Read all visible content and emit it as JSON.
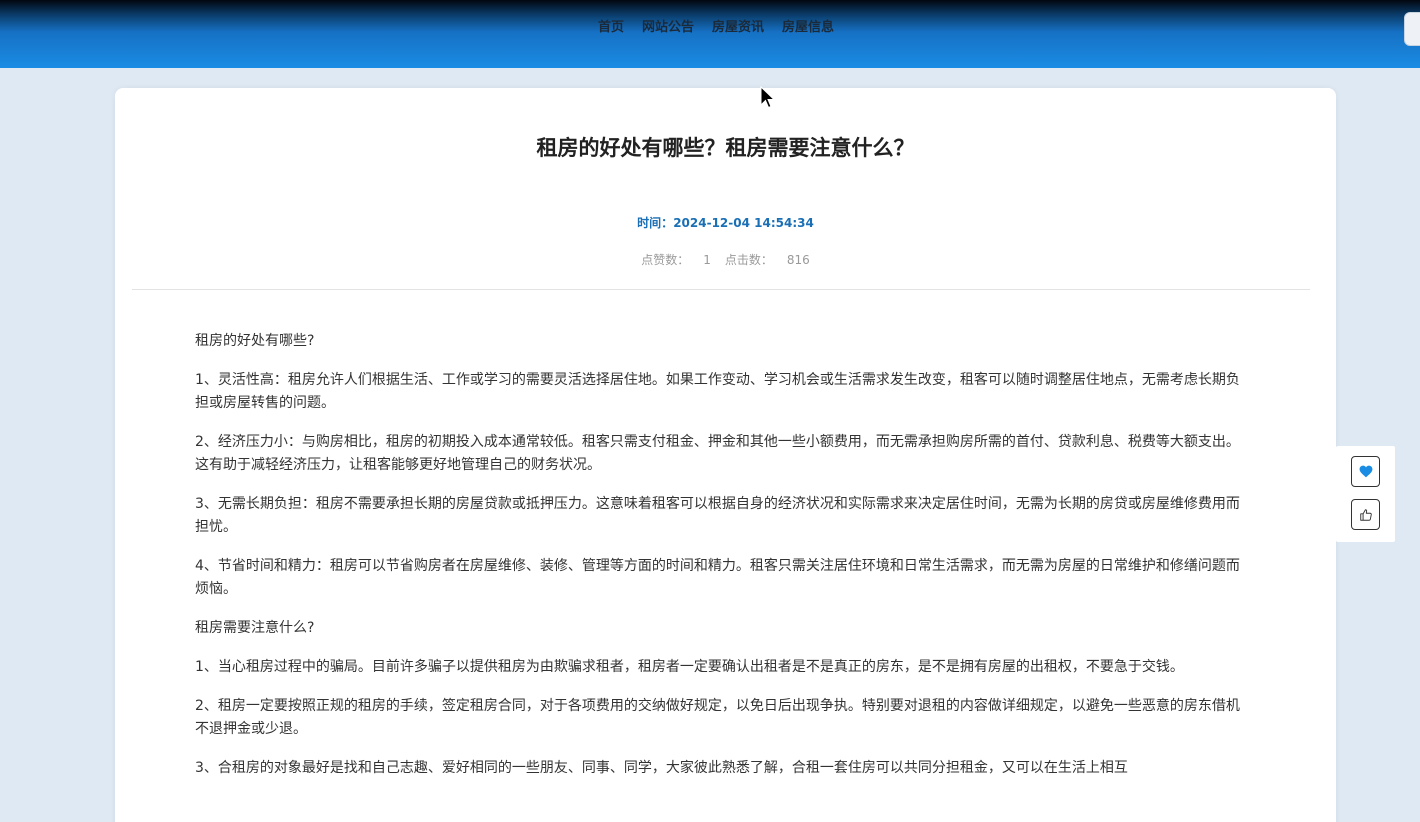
{
  "nav": {
    "items": [
      "首页",
      "网站公告",
      "房屋资讯",
      "房屋信息"
    ]
  },
  "article": {
    "title": "租房的好处有哪些？租房需要注意什么？",
    "time_label": "时间：",
    "time_value": "2024-12-04 14:54:34",
    "likes_label": "点赞数：",
    "likes_value": "1",
    "clicks_label": "点击数：",
    "clicks_value": "816",
    "paragraphs": [
      "租房的好处有哪些?",
      "1、灵活性高：租房允许人们根据生活、工作或学习的需要灵活选择居住地。如果工作变动、学习机会或生活需求发生改变，租客可以随时调整居住地点，无需考虑长期负担或房屋转售的问题。",
      "2、经济压力小：与购房相比，租房的初期投入成本通常较低。租客只需支付租金、押金和其他一些小额费用，而无需承担购房所需的首付、贷款利息、税费等大额支出。这有助于减轻经济压力，让租客能够更好地管理自己的财务状况。",
      "3、无需长期负担：租房不需要承担长期的房屋贷款或抵押压力。这意味着租客可以根据自身的经济状况和实际需求来决定居住时间，无需为长期的房贷或房屋维修费用而担忧。",
      "4、节省时间和精力：租房可以节省购房者在房屋维修、装修、管理等方面的时间和精力。租客只需关注居住环境和日常生活需求，而无需为房屋的日常维护和修缮问题而烦恼。",
      "租房需要注意什么?",
      "1、当心租房过程中的骗局。目前许多骗子以提供租房为由欺骗求租者，租房者一定要确认出租者是不是真正的房东，是不是拥有房屋的出租权，不要急于交钱。",
      "2、租房一定要按照正规的租房的手续，签定租房合同，对于各项费用的交纳做好规定，以免日后出现争执。特别要对退租的内容做详细规定，以避免一些恶意的房东借机不退押金或少退。",
      "3、合租房的对象最好是找和自己志趣、爱好相同的一些朋友、同事、同学，大家彼此熟悉了解，合租一套住房可以共同分担租金，又可以在生活上相互"
    ]
  },
  "side": {
    "favorite_icon": "heart-icon",
    "like_icon": "thumbs-up-icon"
  },
  "colors": {
    "header_top": "#02070f",
    "header_bottom": "#1a8ce4",
    "time_text": "#1a6fb5",
    "favorite_heart": "#1a8ce4"
  }
}
